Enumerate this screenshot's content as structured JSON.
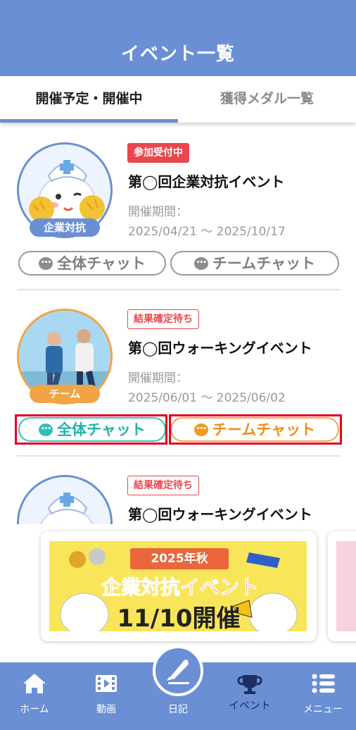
{
  "header": {
    "title": "イベント一覧"
  },
  "tabs": [
    {
      "label": "開催予定・開催中",
      "active": true
    },
    {
      "label": "獲得メダル一覧",
      "active": false
    }
  ],
  "events": [
    {
      "status": "参加受付中",
      "title": "第◯回企業対抗イベント",
      "period_label": "開催期間：",
      "period": "2025/04/21 〜 2025/10/17",
      "tag": "企業対抗",
      "chat_all": "全体チャット",
      "chat_team": "チームチャット"
    },
    {
      "status": "結果確定待ち",
      "title": "第◯回ウォーキングイベント",
      "period_label": "開催期間：",
      "period": "2025/06/01 〜 2025/06/02",
      "tag": "チーム",
      "chat_all": "全体チャット",
      "chat_team": "チームチャット"
    },
    {
      "status": "結果確定待ち",
      "title": "第◯回ウォーキングイベント"
    }
  ],
  "banner": {
    "ribbon": "2025年秋",
    "headline": "企業対抗イベント",
    "date": "11/10開催"
  },
  "bottom_nav": [
    {
      "label": "ホーム",
      "icon": "home-icon"
    },
    {
      "label": "動画",
      "icon": "video-icon"
    },
    {
      "label": "日記",
      "icon": "pen-icon"
    },
    {
      "label": "イベント",
      "icon": "trophy-icon"
    },
    {
      "label": "メニュー",
      "icon": "menu-icon"
    }
  ],
  "colors": {
    "primary": "#6b8fd4",
    "accent_orange": "#f0a445",
    "badge_red": "#e8474c",
    "chat_teal": "#31c3b8",
    "highlight_red": "#e3001b"
  }
}
